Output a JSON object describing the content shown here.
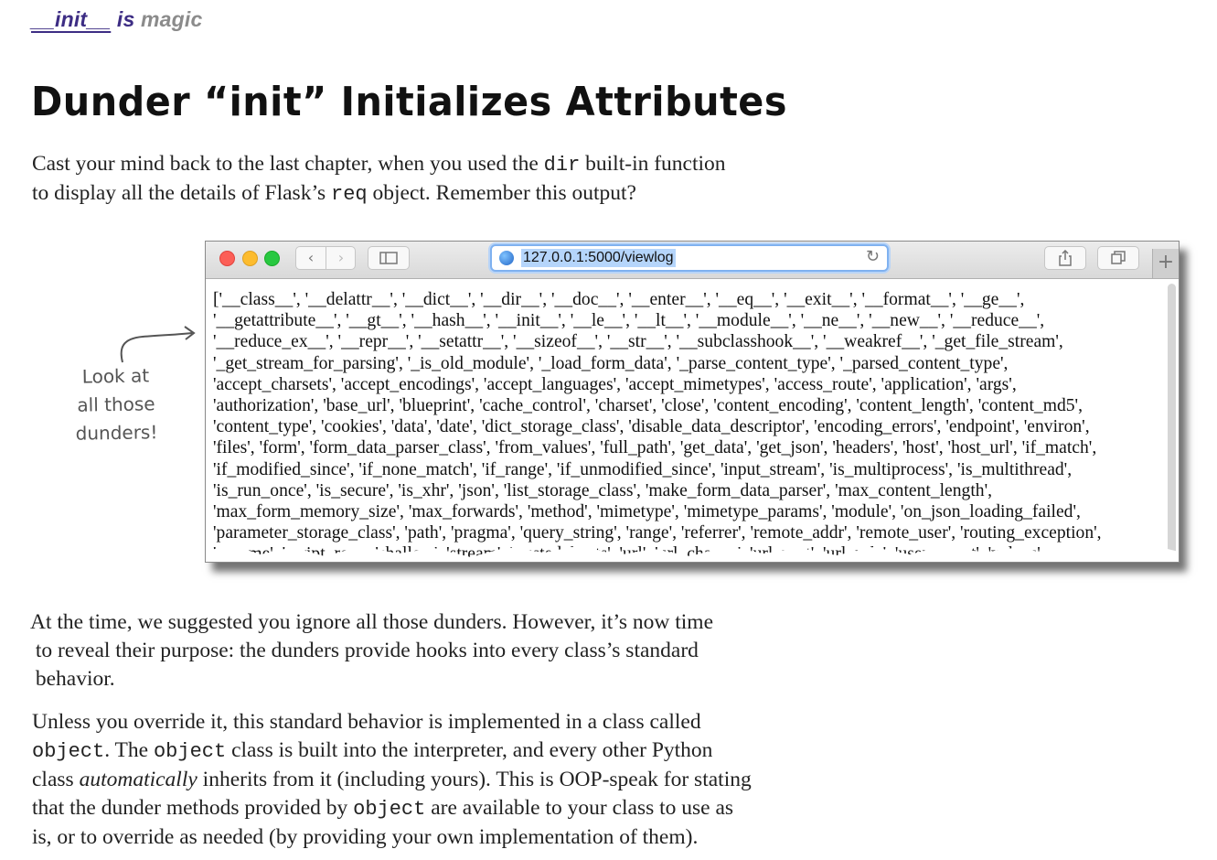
{
  "running_head": {
    "code_part": "__init__",
    "is_word": " is",
    "magic": "magic"
  },
  "title": "Dunder “init” Initializes Attributes",
  "intro": {
    "line1_a": "Cast your mind back to the last chapter, when you used the ",
    "line1_code": "dir",
    "line1_b": " built-in function",
    "line2_a": "to display all the details of Flask’s ",
    "line2_code": "req",
    "line2_b": " object. Remember this output?"
  },
  "note": {
    "lines": [
      "Look at",
      "all those",
      "dunders!"
    ]
  },
  "browser": {
    "url": "127.0.0.1:5000/viewlog",
    "back_icon": "chevron-left-icon",
    "forward_icon": "chevron-right-icon",
    "sidebar_icon": "sidebar-icon",
    "reload_icon": "reload-icon",
    "share_icon": "share-icon",
    "tabs_icon": "tabs-icon",
    "new_tab_label": "+",
    "output_lines": [
      "['__class__', '__delattr__', '__dict__', '__dir__', '__doc__', '__enter__', '__eq__', '__exit__', '__format__', '__ge__',",
      "'__getattribute__', '__gt__', '__hash__', '__init__', '__le__', '__lt__', '__module__', '__ne__', '__new__', '__reduce__',",
      "'__reduce_ex__', '__repr__', '__setattr__', '__sizeof__', '__str__', '__subclasshook__', '__weakref__', '_get_file_stream',",
      "'_get_stream_for_parsing', '_is_old_module', '_load_form_data', '_parse_content_type', '_parsed_content_type',",
      "'accept_charsets', 'accept_encodings', 'accept_languages', 'accept_mimetypes', 'access_route', 'application', 'args',",
      "'authorization', 'base_url', 'blueprint', 'cache_control', 'charset', 'close', 'content_encoding', 'content_length', 'content_md5',",
      "'content_type', 'cookies', 'data', 'date', 'dict_storage_class', 'disable_data_descriptor', 'encoding_errors', 'endpoint', 'environ',",
      "'files', 'form', 'form_data_parser_class', 'from_values', 'full_path', 'get_data', 'get_json', 'headers', 'host', 'host_url', 'if_match',",
      "'if_modified_since', 'if_none_match', 'if_range', 'if_unmodified_since', 'input_stream', 'is_multiprocess', 'is_multithread',",
      "'is_run_once', 'is_secure', 'is_xhr', 'json', 'list_storage_class', 'make_form_data_parser', 'max_content_length',",
      "'max_form_memory_size', 'max_forwards', 'method', 'mimetype', 'mimetype_params', 'module', 'on_json_loading_failed',",
      "'parameter_storage_class', 'path', 'pragma', 'query_string', 'range', 'referrer', 'remote_addr', 'remote_user', 'routing_exception',",
      "'scheme', 'script_root', 'shallow', 'stream', 'trusted_hosts', 'url', 'url_charset', 'url_root', 'url_rule', 'user_agent', 'values',"
    ]
  },
  "para2": {
    "line1": "At the time, we suggested you ignore all those dunders. However, it’s now time",
    "line2": "to reveal their purpose: the dunders provide hooks into every class’s standard",
    "line3": "behavior."
  },
  "para3": {
    "line1": "Unless you override it, this standard behavior is implemented in a class called",
    "line2_code": "object",
    "line2_a": ". The ",
    "line2_code2": "object",
    "line2_b": " class is built into the interpreter, and every other Python",
    "line3_a": "class ",
    "line3_em": "automatically",
    "line3_b": " inherits from it (including yours). This is OOP-speak for stating",
    "line4_a": "that the dunder methods provided by ",
    "line4_code": "object",
    "line4_b": " are available to your class to use as",
    "line5": "is, or to override as needed (by providing your own implementation of them)."
  }
}
